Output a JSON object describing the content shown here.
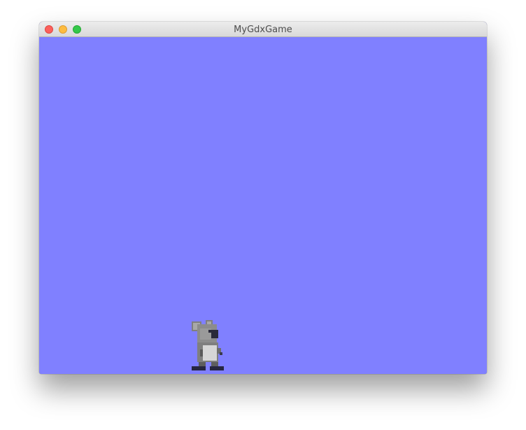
{
  "window": {
    "title": "MyGdxGame",
    "controls": {
      "close": "close",
      "minimize": "minimize",
      "zoom": "zoom"
    }
  },
  "game": {
    "background_color": "#8080ff",
    "sprite": "koala-icon"
  }
}
